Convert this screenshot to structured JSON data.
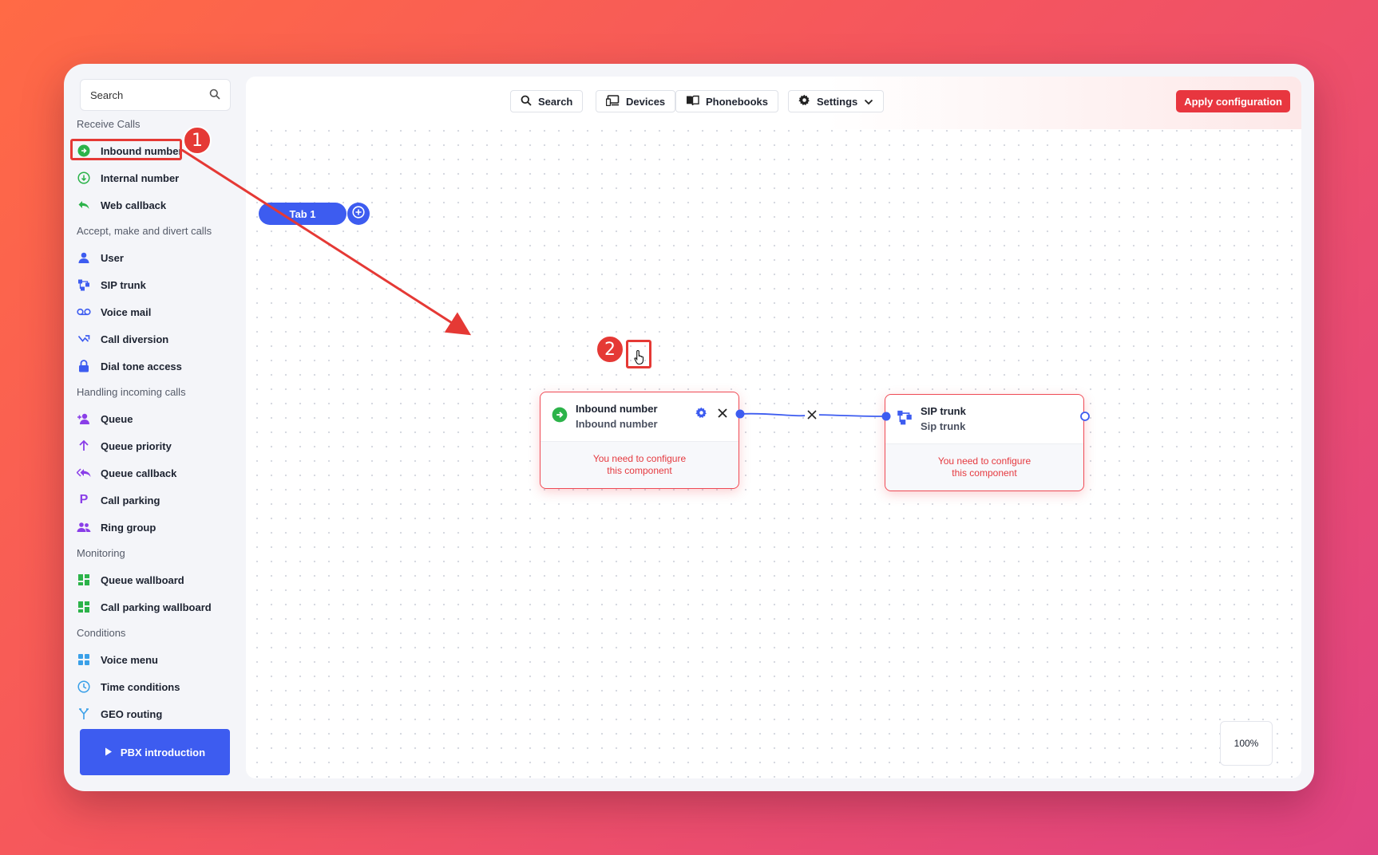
{
  "sidebar": {
    "search_label": "Search",
    "sections": [
      {
        "title": "Receive Calls",
        "items": [
          {
            "label": "Inbound number",
            "icon": "arrow-circle-icon",
            "color": "#2cb34a"
          },
          {
            "label": "Internal number",
            "icon": "down-circle-icon",
            "color": "#2cb34a"
          },
          {
            "label": "Web callback",
            "icon": "reply-icon",
            "color": "#2cb34a"
          }
        ]
      },
      {
        "title": "Accept, make and divert calls",
        "items": [
          {
            "label": "User",
            "icon": "user-icon",
            "color": "#3d5cf0"
          },
          {
            "label": "SIP trunk",
            "icon": "network-icon",
            "color": "#3d5cf0"
          },
          {
            "label": "Voice mail",
            "icon": "voicemail-icon",
            "color": "#3d5cf0"
          },
          {
            "label": "Call diversion",
            "icon": "divert-icon",
            "color": "#3d5cf0"
          },
          {
            "label": "Dial tone access",
            "icon": "lock-icon",
            "color": "#3d5cf0"
          }
        ]
      },
      {
        "title": "Handling incoming calls",
        "items": [
          {
            "label": "Queue",
            "icon": "user-plus-icon",
            "color": "#8a3ee8"
          },
          {
            "label": "Queue priority",
            "icon": "arrow-up-icon",
            "color": "#8a3ee8"
          },
          {
            "label": "Queue callback",
            "icon": "reply-all-icon",
            "color": "#8a3ee8"
          },
          {
            "label": "Call parking",
            "icon": "parking-icon",
            "color": "#8a3ee8"
          },
          {
            "label": "Ring group",
            "icon": "users-icon",
            "color": "#8a3ee8"
          }
        ]
      },
      {
        "title": "Monitoring",
        "items": [
          {
            "label": "Queue wallboard",
            "icon": "dashboard-icon",
            "color": "#2cb34a"
          },
          {
            "label": "Call parking wallboard",
            "icon": "dashboard-icon",
            "color": "#2cb34a"
          }
        ]
      },
      {
        "title": "Conditions",
        "items": [
          {
            "label": "Voice menu",
            "icon": "grid-icon",
            "color": "#3aa0e8"
          },
          {
            "label": "Time conditions",
            "icon": "clock-icon",
            "color": "#3aa0e8"
          },
          {
            "label": "GEO routing",
            "icon": "fork-icon",
            "color": "#3aa0e8"
          }
        ]
      }
    ],
    "pbx_intro_label": "PBX introduction"
  },
  "toolbar": {
    "search_label": "Search",
    "devices_label": "Devices",
    "phonebooks_label": "Phonebooks",
    "settings_label": "Settings",
    "apply_label": "Apply configuration"
  },
  "tabs": [
    {
      "label": "Tab 1"
    }
  ],
  "nodes": {
    "inbound": {
      "title": "Inbound number",
      "subtitle": "Inbound number",
      "warning_line1": "You need to configure",
      "warning_line2": "this component"
    },
    "sip": {
      "title": "SIP trunk",
      "subtitle": "Sip trunk",
      "warning_line1": "You need to configure",
      "warning_line2": "this component"
    }
  },
  "zoom_label": "100%",
  "annotations": {
    "step1": "1",
    "step2": "2"
  },
  "colors": {
    "accent": "#3d5cf0",
    "danger": "#e8363f",
    "annotation": "#e53935"
  }
}
